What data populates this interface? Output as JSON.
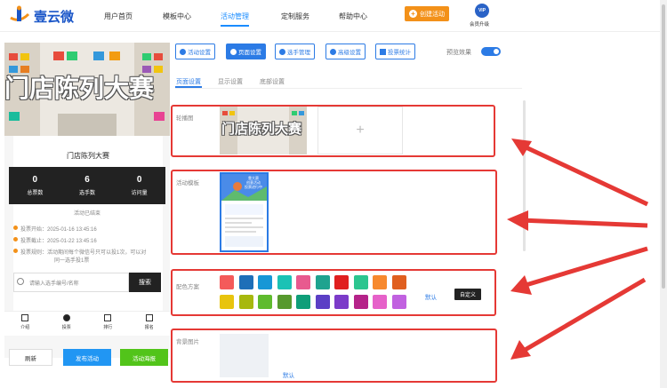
{
  "header": {
    "logo_text": "壹云微",
    "nav": [
      "用户首页",
      "模板中心",
      "活动管理",
      "定制服务",
      "帮助中心"
    ],
    "active_nav": "活动管理",
    "create_button": "创建活动",
    "vip_badge": "VIP",
    "vip_label": "会员升级"
  },
  "preview": {
    "banner_title": "门店陈列大赛",
    "activity_name": "门店陈列大赛",
    "stats": [
      {
        "value": "0",
        "label": "总票数"
      },
      {
        "value": "6",
        "label": "选手数"
      },
      {
        "value": "0",
        "label": "访问量"
      }
    ],
    "status": "活动已结束",
    "vote_start": "投票开始：2025-01-16 13:45:16",
    "vote_end": "投票截止：2025-01-22 13:45:16",
    "rule_line1": "投票规则：活动期间每个微信号只可以投1次，可以对",
    "rule_line2": "同一选手投1票",
    "search_placeholder": "请输入选手编号/名称",
    "search_button": "搜索",
    "tabs": [
      "介绍",
      "投票",
      "排行",
      "报名"
    ],
    "refresh": "刷新",
    "publish": "发布活动",
    "poster": "活动海报"
  },
  "settings": {
    "tabs": [
      "活动设置",
      "页面设置",
      "选手管理",
      "高级设置",
      "投票统计"
    ],
    "active_tab": "页面设置",
    "preview_label": "预览效果",
    "subtabs": [
      "页面设置",
      "显示设置",
      "底部设置"
    ],
    "sections": {
      "carousel": "轮播图",
      "carousel_title": "门店陈列大赛",
      "template": "活动模板",
      "color": "配色方案",
      "background": "背景图片"
    },
    "template_thumb": {
      "title_line1": "靠大赛",
      "title_line2": "创意活动",
      "title_line3": "投票进行中"
    },
    "color_swatches": [
      "#f45a5a",
      "#1e6fb8",
      "#1797d6",
      "#1bc2b5",
      "#e85a8f",
      "#1fa38f",
      "#e01f1f",
      "#2cc58f",
      "#f7892e",
      "#e05f1f",
      "#e8c40d",
      "#a7b80e",
      "#5fbb2e",
      "#57992e",
      "#0f9e79",
      "#5b3fc5",
      "#7c3bc9",
      "#b52389",
      "#e661c9",
      "#c161e0"
    ],
    "default_label": "默认",
    "custom_label": "自定义",
    "bg_default": "默认"
  }
}
